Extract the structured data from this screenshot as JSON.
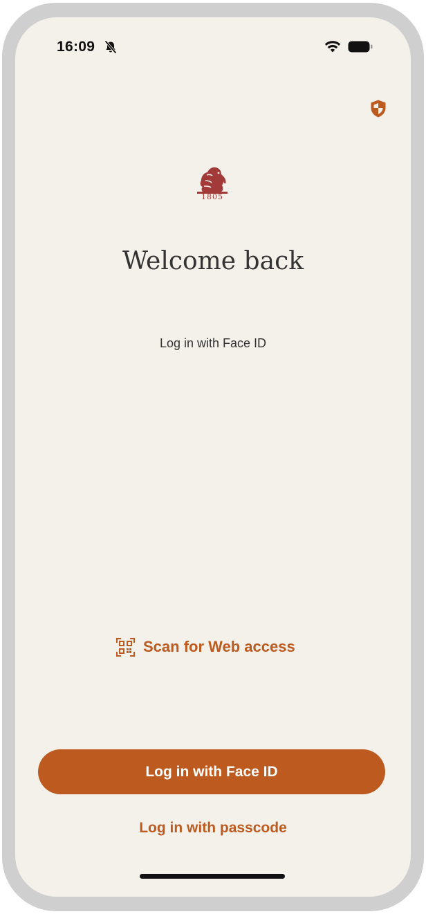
{
  "status_bar": {
    "time": "16:09",
    "icons": [
      "bell-slash-icon",
      "wifi-icon",
      "battery-icon"
    ]
  },
  "header": {
    "security_icon": "shield-icon"
  },
  "logo": {
    "year": "1805",
    "icon": "lion-logo"
  },
  "main": {
    "title": "Welcome back",
    "subtitle": "Log in with Face ID"
  },
  "actions": {
    "scan_label": "Scan for Web access",
    "scan_icon": "qr-code-icon",
    "face_id_button_label": "Log in with Face ID",
    "passcode_label": "Log in with passcode"
  },
  "colors": {
    "accent": "#bd5a1f",
    "background": "#f4f1ea",
    "logo": "#a23a3a",
    "text": "#333333"
  }
}
